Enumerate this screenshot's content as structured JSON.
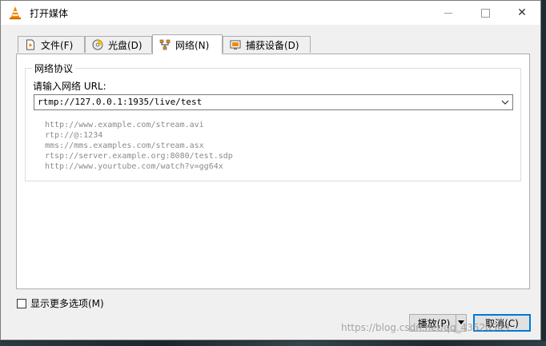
{
  "window": {
    "title": "打开媒体",
    "controls": {
      "minimize": "minimize",
      "maximize": "maximize",
      "close": "✕"
    }
  },
  "tabs": [
    {
      "label": "文件(F)",
      "icon": "file-icon"
    },
    {
      "label": "光盘(D)",
      "icon": "disc-icon"
    },
    {
      "label": "网络(N)",
      "icon": "network-icon",
      "active": true
    },
    {
      "label": "捕获设备(D)",
      "icon": "capture-device-icon"
    }
  ],
  "network": {
    "group_title": "网络协议",
    "url_label": "请输入网络 URL:",
    "url_value": "rtmp://127.0.0.1:1935/live/test",
    "examples": [
      "http://www.example.com/stream.avi",
      "rtp://@:1234",
      "mms://mms.examples.com/stream.asx",
      "rtsp://server.example.org:8080/test.sdp",
      "http://www.yourtube.com/watch?v=gg64x"
    ]
  },
  "options": {
    "more_options_label": "显示更多选项(M)",
    "more_options_checked": false
  },
  "buttons": {
    "play": "播放(P)",
    "cancel": "取消(C)"
  },
  "watermark": "https://blog.csdn.net/qq_43520549",
  "colors": {
    "accent": "#0078d7",
    "vlc_orange": "#f18a00"
  }
}
